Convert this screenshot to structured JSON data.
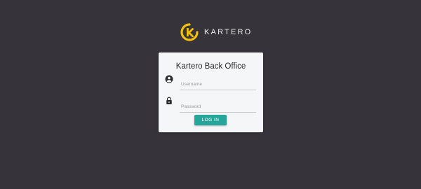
{
  "brand": {
    "name": "KARTERO",
    "logo_icon": "kartero-k-logo",
    "accent_color": "#f2c10a"
  },
  "login": {
    "title": "Kartero Back Office",
    "username": {
      "placeholder": "Username",
      "value": "",
      "icon": "account-circle-icon"
    },
    "password": {
      "placeholder": "Password",
      "value": "",
      "icon": "lock-icon"
    },
    "submit_label": "LOG IN",
    "button_color": "#26a69a"
  },
  "page": {
    "background_color": "#37333a"
  }
}
